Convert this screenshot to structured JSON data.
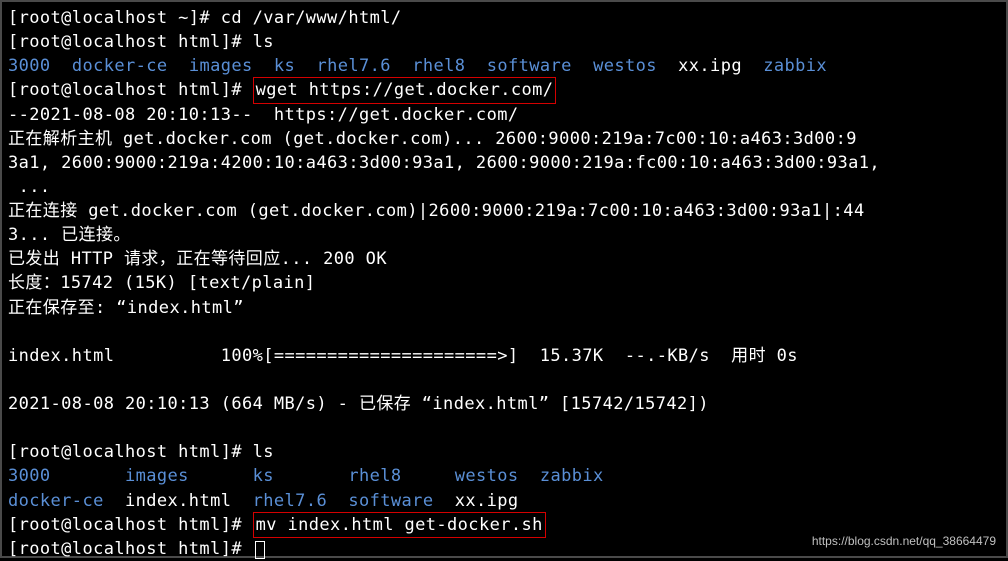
{
  "lines": [
    {
      "prompt": "[root@localhost ~]# ",
      "cmd": "cd /var/www/html/"
    },
    {
      "prompt": "[root@localhost html]# ",
      "cmd": "ls"
    }
  ],
  "ls1": {
    "dirs": [
      "3000",
      "docker-ce",
      "images",
      "ks",
      "rhel7.6",
      "rhel8",
      "software",
      "westos"
    ],
    "files": [
      "xx.ipg"
    ],
    "dirs_after": [
      "zabbix"
    ]
  },
  "wget": {
    "prompt": "[root@localhost html]# ",
    "cmd": "wget https://get.docker.com/",
    "out1": "--2021-08-08 20:10:13--  https://get.docker.com/",
    "out2": "正在解析主机 get.docker.com (get.docker.com)... 2600:9000:219a:7c00:10:a463:3d00:9",
    "out3": "3a1, 2600:9000:219a:4200:10:a463:3d00:93a1, 2600:9000:219a:fc00:10:a463:3d00:93a1,",
    "out4": " ...",
    "out5": "正在连接 get.docker.com (get.docker.com)|2600:9000:219a:7c00:10:a463:3d00:93a1|:44",
    "out6": "3... 已连接。",
    "out7": "已发出 HTTP 请求，正在等待回应... 200 OK",
    "out8": "长度：15742 (15K) [text/plain]",
    "out9": "正在保存至: “index.html”",
    "out10": "index.html          100%[=====================>]  15.37K  --.-KB/s  用时 0s",
    "out11": "2021-08-08 20:10:13 (664 MB/s) - 已保存 “index.html” [15742/15742])"
  },
  "ls2": {
    "prompt": "[root@localhost html]# ",
    "cmd": "ls",
    "row1_dirs": [
      "3000",
      "images",
      "ks",
      "rhel8",
      "westos",
      "zabbix"
    ],
    "row2_dirs": [
      "docker-ce"
    ],
    "row2_file1": "index.html",
    "row2_dirs2": [
      "rhel7.6",
      "software"
    ],
    "row2_file2": "xx.ipg"
  },
  "mv": {
    "prompt": "[root@localhost html]# ",
    "cmd": "mv index.html get-docker.sh"
  },
  "last": {
    "prompt": "[root@localhost html]# "
  },
  "watermark": "https://blog.csdn.net/qq_38664479"
}
